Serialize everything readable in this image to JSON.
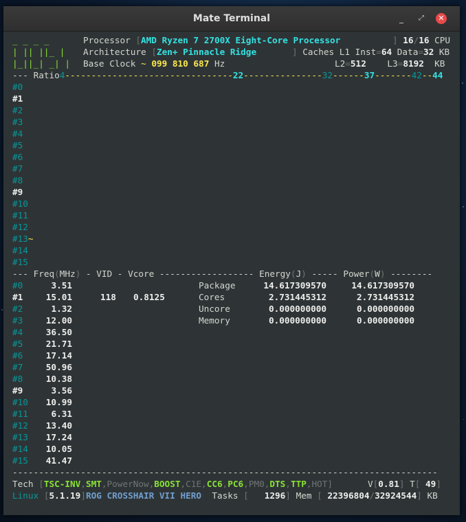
{
  "window": {
    "title": "Mate Terminal",
    "minimize": "_",
    "maximize": "⤢",
    "close": "✕"
  },
  "header": {
    "logo": [
      "_ _ _ _",
      "| || ||_ |",
      "|_||_| _| |"
    ],
    "processor_label": "Processor",
    "processor_value": "AMD Ryzen 7 2700X Eight-Core Processor",
    "cpu_count": "16",
    "cpu_total": "16",
    "cpu_label": "CPU",
    "architecture_label": "Architecture",
    "architecture_value": "Zen+ Pinnacle Ridge",
    "caches_label": "Caches L1 Inst",
    "l1_inst": "64",
    "data_label": "Data",
    "l1_data": "32",
    "kb": "KB",
    "base_clock_label": "Base Clock",
    "base_clock_value": "099 810 687",
    "hz": "Hz",
    "l2_label": "L2",
    "l2_value": "512",
    "l3_label": "L3",
    "l3_value": "8192"
  },
  "ratio_bar": {
    "label": "Ratio",
    "min": "4",
    "r22": "22",
    "r32": "32",
    "r37": "37",
    "r42": "42",
    "r44": "44"
  },
  "ratio_cores": [
    "#0",
    "#1",
    "#2",
    "#3",
    "#4",
    "#5",
    "#6",
    "#7",
    "#8",
    "#9",
    "#10",
    "#11",
    "#12",
    "#13",
    "#14",
    "#15"
  ],
  "ratio_marker_13": "~",
  "freq_header": {
    "freq": "Freq",
    "mhz": "MHz",
    "vid": "VID",
    "vcore": "Vcore",
    "energy": "Energy",
    "joule": "J",
    "power": "Power",
    "watt": "W"
  },
  "cores": [
    {
      "id": "#0",
      "freq": "3.51"
    },
    {
      "id": "#1",
      "freq": "15.01",
      "vid": "118",
      "vcore": "0.8125"
    },
    {
      "id": "#2",
      "freq": "1.32"
    },
    {
      "id": "#3",
      "freq": "12.00"
    },
    {
      "id": "#4",
      "freq": "36.50"
    },
    {
      "id": "#5",
      "freq": "21.71"
    },
    {
      "id": "#6",
      "freq": "17.14"
    },
    {
      "id": "#7",
      "freq": "50.96"
    },
    {
      "id": "#8",
      "freq": "10.38"
    },
    {
      "id": "#9",
      "freq": "3.56"
    },
    {
      "id": "#10",
      "freq": "10.99"
    },
    {
      "id": "#11",
      "freq": "6.31"
    },
    {
      "id": "#12",
      "freq": "13.40"
    },
    {
      "id": "#13",
      "freq": "17.24"
    },
    {
      "id": "#14",
      "freq": "10.05"
    },
    {
      "id": "#15",
      "freq": "41.47"
    }
  ],
  "power_table": [
    {
      "name": "Package",
      "energy": "14.617309570",
      "power": "14.617309570"
    },
    {
      "name": "Cores",
      "energy": "2.731445312",
      "power": "2.731445312"
    },
    {
      "name": "Uncore",
      "energy": "0.000000000",
      "power": "0.000000000"
    },
    {
      "name": "Memory",
      "energy": "0.000000000",
      "power": "0.000000000"
    }
  ],
  "tech": {
    "label": "Tech",
    "flags": [
      {
        "text": "TSC-INV",
        "on": true
      },
      {
        "text": "SMT",
        "on": true
      },
      {
        "text": "PowerNow",
        "on": false
      },
      {
        "text": "BOOST",
        "on": true
      },
      {
        "text": "C1E",
        "on": false
      },
      {
        "text": "CC6",
        "on": true
      },
      {
        "text": "PC6",
        "on": true
      },
      {
        "text": "PM0",
        "on": false
      },
      {
        "text": "DTS",
        "on": true
      },
      {
        "text": "TTP",
        "on": true
      },
      {
        "text": "HOT",
        "on": false
      }
    ],
    "v_label": "V",
    "v_value": "0.81",
    "t_label": "T",
    "t_value": "49"
  },
  "system": {
    "os": "Linux",
    "kernel": "5.1.19",
    "board": "ROG CROSSHAIR VII HERO",
    "tasks_label": "Tasks",
    "tasks_value": "1296",
    "mem_label": "Mem",
    "mem_used": "22396804",
    "mem_total": "32924544",
    "kb": "KB"
  },
  "colors": {
    "background": "#2e3436",
    "foreground": "#d3d7cf",
    "cyan": "#34e2e2",
    "green": "#8ae234",
    "yellow": "#fce94f",
    "close_button": "#e84a4a"
  }
}
